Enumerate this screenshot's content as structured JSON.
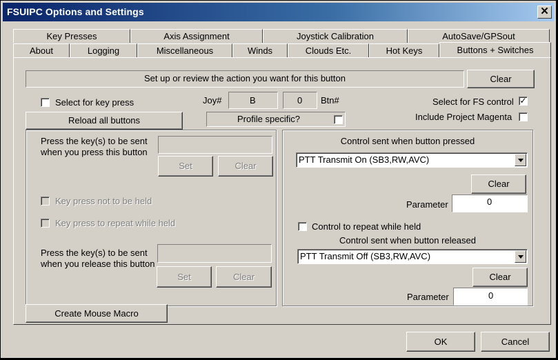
{
  "window": {
    "title": "FSUIPC Options and Settings",
    "close_glyph": "✕"
  },
  "tabs_row1": [
    "Key Presses",
    "Axis Assignment",
    "Joystick Calibration",
    "AutoSave/GPSout"
  ],
  "tabs_row2": [
    "About",
    "Logging",
    "Miscellaneous",
    "Winds",
    "Clouds Etc.",
    "Hot Keys",
    "Buttons + Switches"
  ],
  "header": {
    "instruction": "Set up or review the action you want for this button",
    "clear_label": "Clear"
  },
  "top": {
    "select_key_press": "Select for key press",
    "joy_label": "Joy#",
    "joy_value": "B",
    "btn_value": "0",
    "btn_label": "Btn#",
    "select_fs_control": "Select for FS control",
    "fs_control_checked": "✓",
    "include_magenta": "Include Project Magenta",
    "reload_all": "Reload all buttons",
    "profile_specific": "Profile specific?"
  },
  "left": {
    "press_label": "Press the key(s) to be sent when you press this button",
    "set_label": "Set",
    "clear_label": "Clear",
    "not_held": "Key press not to be held",
    "repeat_held": "Key press to repeat while held",
    "release_label": "Press the key(s) to be sent when you release this button",
    "set2_label": "Set",
    "clear2_label": "Clear",
    "mouse_macro": "Create Mouse Macro"
  },
  "right": {
    "pressed_title": "Control sent when button pressed",
    "pressed_control": "PTT Transmit On (SB3,RW,AVC)",
    "clear1": "Clear",
    "param_label": "Parameter",
    "param1": "0",
    "repeat_while_held": "Control to repeat while held",
    "released_title": "Control sent when button released",
    "released_control": "PTT Transmit Off (SB3,RW,AVC)",
    "clear2": "Clear",
    "param2_label": "Parameter",
    "param2": "0"
  },
  "footer": {
    "ok": "OK",
    "cancel": "Cancel"
  },
  "colors": {
    "title_start": "#0a246a",
    "title_end": "#a6caf0",
    "face": "#d4d0c8"
  }
}
